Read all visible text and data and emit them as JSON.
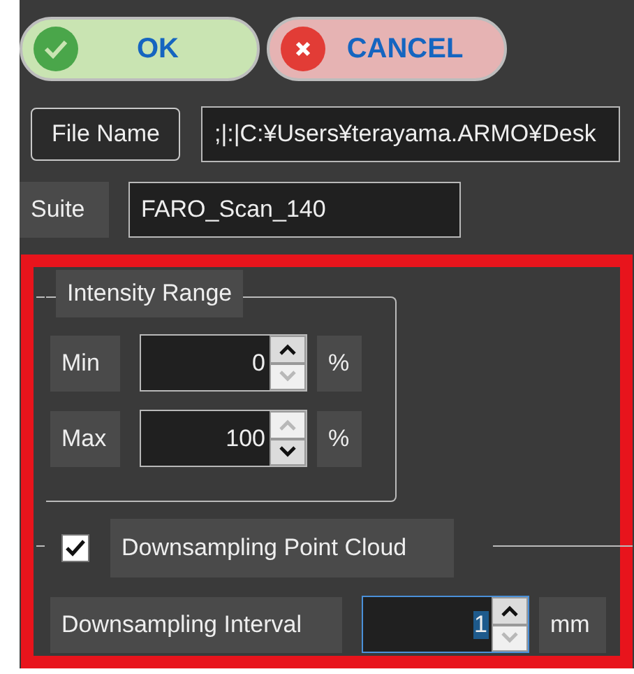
{
  "buttons": [
    {
      "kind": "ok",
      "label": "OK"
    },
    {
      "kind": "cancel",
      "label": "CANCEL"
    }
  ],
  "file_name": {
    "button": "File Name",
    "value": ";|:|C:¥Users¥terayama.ARMO¥Desk"
  },
  "suite": {
    "label": "Suite",
    "value": "FARO_Scan_140"
  },
  "intensity_range": {
    "title": "Intensity Range",
    "rows": [
      {
        "label": "Min",
        "value": "0",
        "unit": "%",
        "up_disabled": false,
        "down_disabled": true
      },
      {
        "label": "Max",
        "value": "100",
        "unit": "%",
        "up_disabled": true,
        "down_disabled": false
      }
    ]
  },
  "downsampling": {
    "label": "Downsampling Point Cloud",
    "checked": true,
    "interval": {
      "label": "Downsampling Interval",
      "value": "1",
      "unit": "mm",
      "focused": true,
      "up_disabled": false,
      "down_disabled": true
    }
  }
}
